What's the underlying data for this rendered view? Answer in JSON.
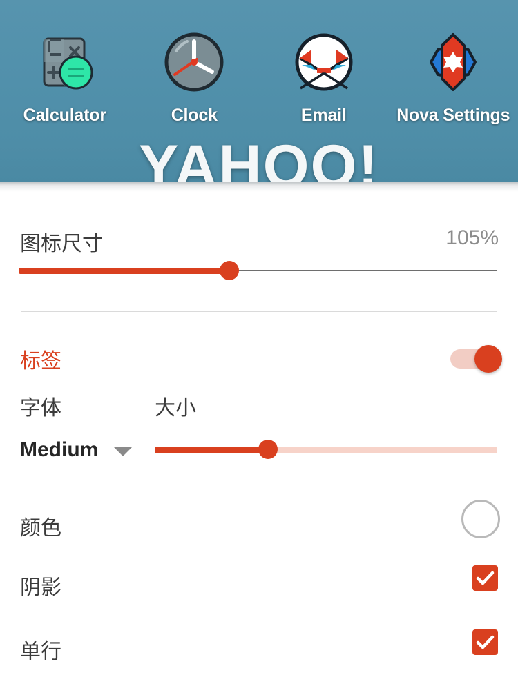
{
  "homescreen": {
    "apps": [
      {
        "label": "Calculator",
        "icon": "calculator-icon"
      },
      {
        "label": "Clock",
        "icon": "clock-icon"
      },
      {
        "label": "Email",
        "icon": "email-icon"
      },
      {
        "label": "Nova Settings",
        "icon": "nova-settings-icon"
      }
    ],
    "widget_text": "YAHOO!",
    "wallpaper_color": "#5190ab"
  },
  "panel": {
    "accent_color": "#d9401f",
    "icon_size": {
      "label": "图标尺寸",
      "value": "105%",
      "slider_percent": 44
    },
    "label_switch": {
      "label": "标签",
      "state": "on"
    },
    "font": {
      "header": "字体",
      "value": "Medium",
      "caret": "chevron-down-icon",
      "options": [
        "Medium"
      ]
    },
    "size": {
      "header": "大小",
      "slider_percent": 33
    },
    "color": {
      "label": "颜色",
      "swatch_color": "#ffffff"
    },
    "shadow": {
      "label": "阴影",
      "checked": "true"
    },
    "single_line": {
      "label": "单行",
      "checked": "true"
    }
  }
}
